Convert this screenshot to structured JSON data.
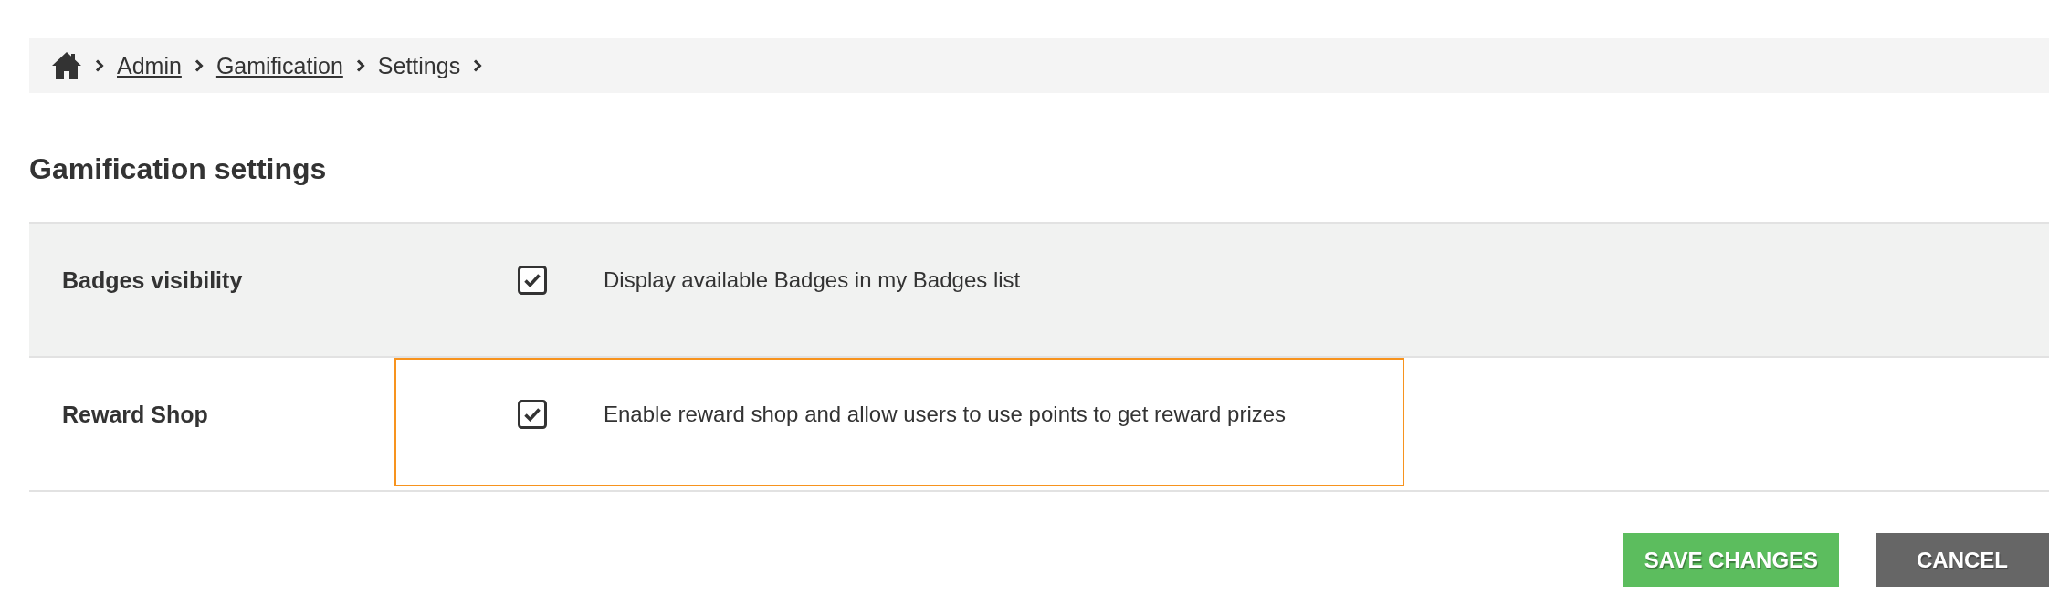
{
  "breadcrumb": [
    {
      "kind": "home"
    },
    {
      "kind": "link",
      "label": "Admin"
    },
    {
      "kind": "link",
      "label": "Gamification"
    },
    {
      "kind": "current",
      "label": "Settings"
    }
  ],
  "heading": "Gamification settings",
  "settings": [
    {
      "label": "Badges visibility",
      "checked": true,
      "description": "Display available Badges in my Badges list",
      "shaded": true,
      "highlighted": false
    },
    {
      "label": "Reward Shop",
      "checked": true,
      "description": "Enable reward shop and allow users to use points to get reward prizes",
      "shaded": false,
      "highlighted": true
    }
  ],
  "buttons": [
    {
      "kind": "primary",
      "label": "SAVE CHANGES"
    },
    {
      "kind": "secondary",
      "label": "CANCEL"
    }
  ]
}
